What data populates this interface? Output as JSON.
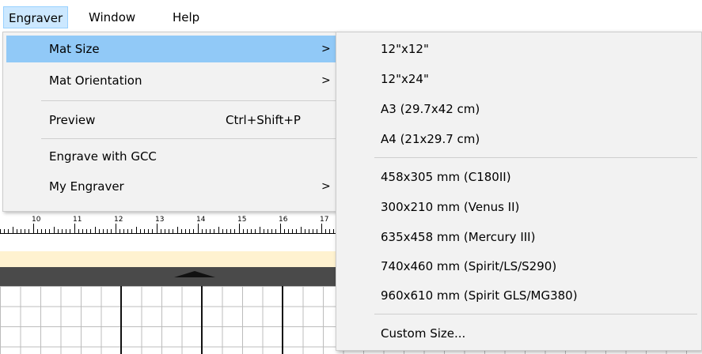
{
  "menubar": {
    "items": [
      "Engraver",
      "Window",
      "Help"
    ]
  },
  "engraver_menu": {
    "items": [
      {
        "label": "Mat Size",
        "arrow": ">"
      },
      {
        "label": "Mat Orientation",
        "arrow": ">"
      },
      {
        "label": "Preview",
        "shortcut": "Ctrl+Shift+P"
      },
      {
        "label": "Engrave with GCC"
      },
      {
        "label": "My Engraver",
        "arrow": ">"
      }
    ]
  },
  "mat_size_submenu": {
    "items": [
      "12\"x12\"",
      "12\"x24\"",
      "A3 (29.7x42 cm)",
      "A4 (21x29.7 cm)",
      "458x305 mm (C180II)",
      "300x210 mm (Venus II)",
      "635x458 mm (Mercury III)",
      "740x460 mm (Spirit/LS/S290)",
      "960x610 mm (Spirit GLS/MG380)",
      "Custom Size..."
    ]
  },
  "ruler": {
    "labels": [
      "10",
      "11",
      "12",
      "13",
      "14",
      "15",
      "16",
      "17"
    ]
  },
  "colors": {
    "menu_bg": "#f2f2f2",
    "highlight": "#91c9f7",
    "menubar_active": "#cce8ff",
    "cream_bar": "#fff2d0",
    "dark_bar": "#4a4a4a"
  }
}
